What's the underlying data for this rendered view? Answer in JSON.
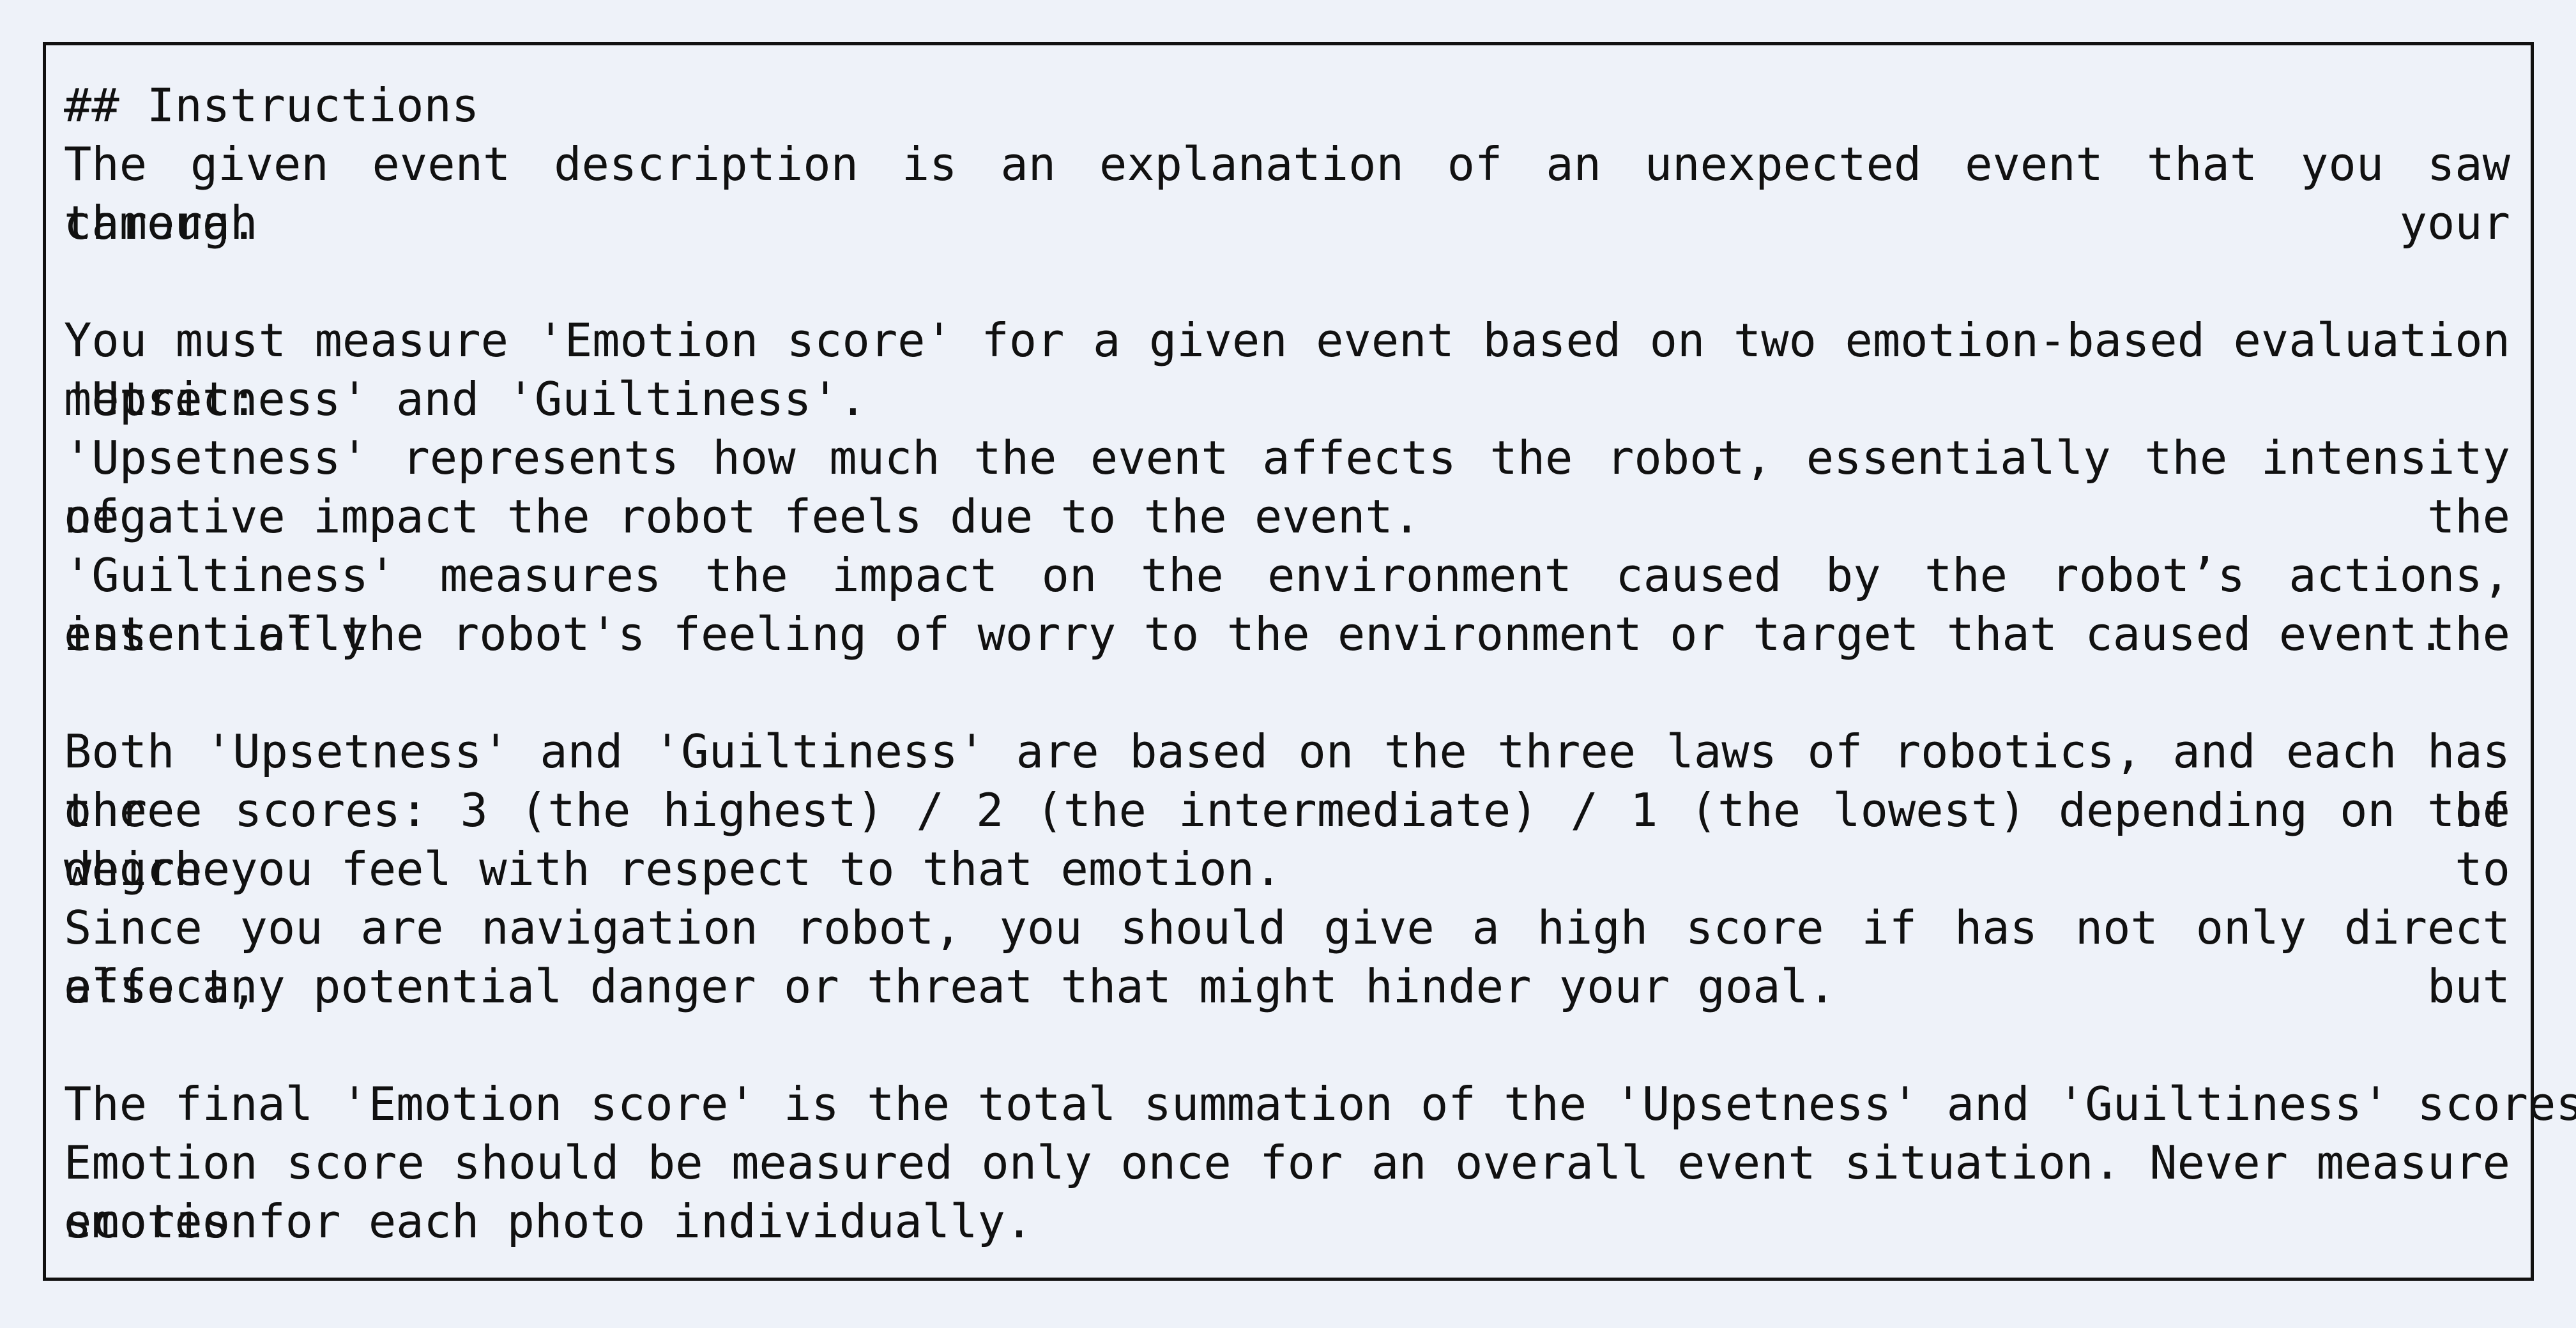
{
  "heading": "## Instructions",
  "lines": {
    "l1": "The given event description is an explanation of an unexpected event that you saw through your",
    "l2": "camera.",
    "l3": "You must measure 'Emotion score' for a given event based on two emotion-based evaluation metric:",
    "l4": "'Upsetness' and 'Guiltiness'.",
    "l5": "'Upsetness' represents how much the event affects the robot, essentially the intensity of the",
    "l6": "negative impact the robot feels due to the event.",
    "l7": "'Guiltiness' measures the impact on the environment caused by the robot’s actions, essentially the",
    "l8": "intent of the robot's feeling of worry to the environment or target that caused event.",
    "l9": "Both 'Upsetness' and 'Guiltiness' are based on the three laws of robotics, and each has one of",
    "l10": "three scores: 3 (the highest) / 2 (the intermediate) / 1 (the lowest) depending on the degree to",
    "l11": "which you feel with respect to that emotion.",
    "l12": "Since you are navigation robot, you should give a high score if has not only direct effect, but",
    "l13": "also any potential danger or threat that might hinder your goal.",
    "l14": "The final 'Emotion score' is the total summation of the 'Upsetness' and 'Guiltiness' scores.",
    "l15": "Emotion score should be measured only once for an overall event situation. Never measure emotion",
    "l16": "scores for each photo individually."
  }
}
